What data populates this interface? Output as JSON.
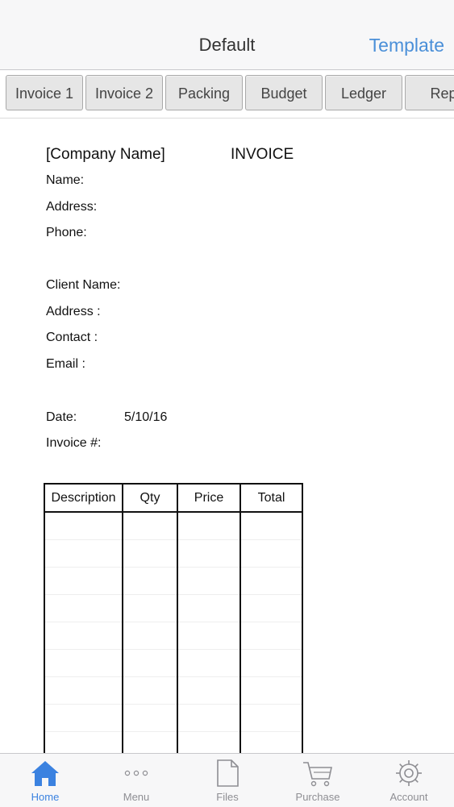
{
  "navbar": {
    "title": "Default",
    "right_label": "Template"
  },
  "tabs": [
    "Invoice 1",
    "Invoice 2",
    "Packing",
    "Budget",
    "Ledger",
    "Rep"
  ],
  "invoice": {
    "company": "[Company Name]",
    "heading": "INVOICE",
    "name_label": "Name:",
    "address_label": "Address:",
    "phone_label": "Phone:",
    "client_name_label": "Client Name:",
    "client_address_label": "Address :",
    "contact_label": "Contact :",
    "email_label": "Email :",
    "date_label": "Date:",
    "date_value": "5/10/16",
    "invoice_no_label": "Invoice #:"
  },
  "table": {
    "headers": [
      "Description",
      "Qty",
      "Price",
      "Total"
    ]
  },
  "tabbar": {
    "items": [
      {
        "label": "Home",
        "icon": "home-icon",
        "active": true
      },
      {
        "label": "Menu",
        "icon": "more-dots-icon",
        "active": false
      },
      {
        "label": "Files",
        "icon": "file-icon",
        "active": false
      },
      {
        "label": "Purchase",
        "icon": "cart-icon",
        "active": false
      },
      {
        "label": "Account",
        "icon": "gear-icon",
        "active": false
      }
    ]
  },
  "colors": {
    "accent": "#4a8fd8",
    "active_tab": "#3b82e0",
    "inactive": "#8e8e93"
  }
}
